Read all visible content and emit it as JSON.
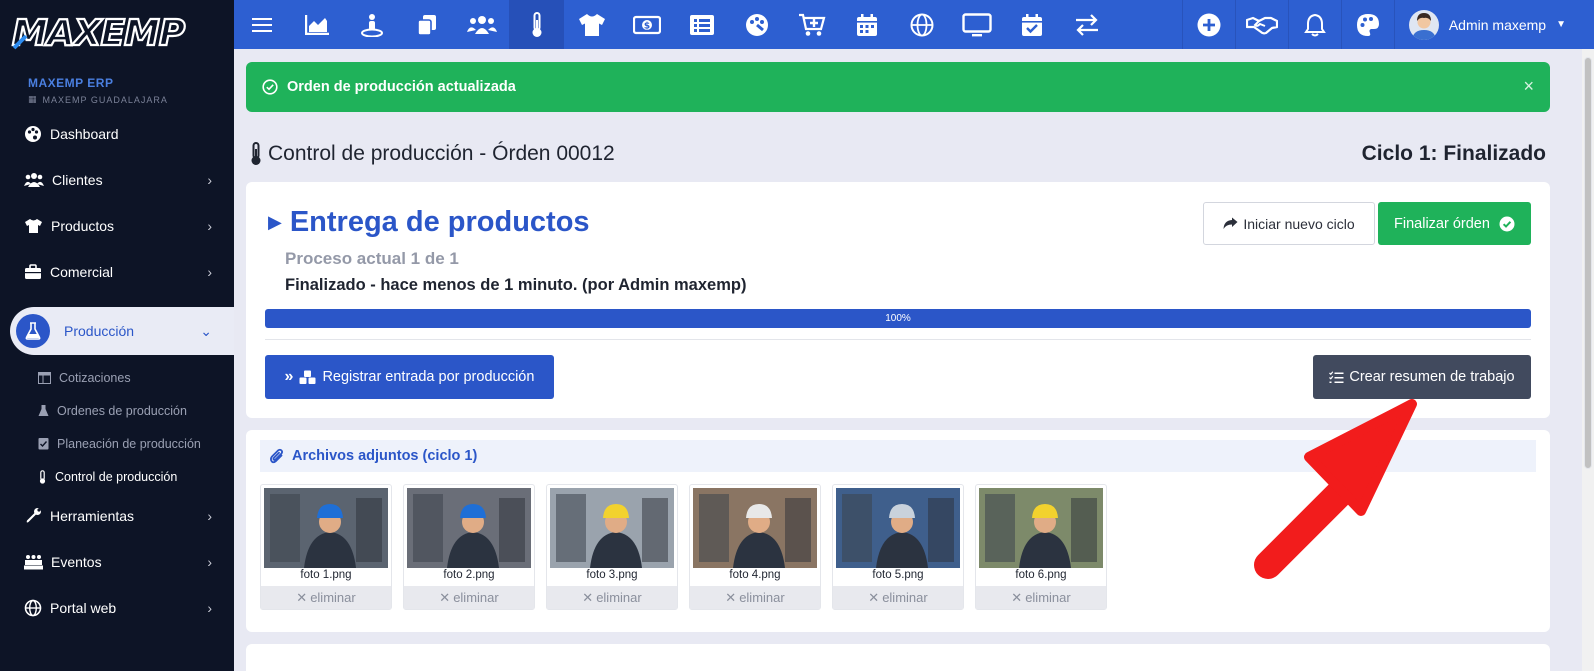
{
  "brand": {
    "logo_text": "MAXEMP",
    "org_name": "MAXEMP ERP",
    "org_sub": "MAXEMP GUADALAJARA"
  },
  "sidebar": {
    "items": [
      {
        "label": "Dashboard",
        "icon": "palette-icon"
      },
      {
        "label": "Clientes",
        "icon": "users-icon"
      },
      {
        "label": "Productos",
        "icon": "shirt-icon"
      },
      {
        "label": "Comercial",
        "icon": "briefcase-icon"
      },
      {
        "label": "Producción",
        "icon": "flask-icon",
        "active": true
      },
      {
        "label": "Herramientas",
        "icon": "wrench-icon"
      },
      {
        "label": "Eventos",
        "icon": "people-group-icon"
      },
      {
        "label": "Portal web",
        "icon": "globe-icon"
      }
    ],
    "sub_items": [
      {
        "label": "Cotizaciones",
        "icon": "table-icon"
      },
      {
        "label": "Ordenes de producción",
        "icon": "flask-icon"
      },
      {
        "label": "Planeación de producción",
        "icon": "checklist-icon"
      },
      {
        "label": "Control de producción",
        "icon": "thermometer-icon",
        "current": true
      }
    ]
  },
  "topbar": {
    "icons": [
      "menu-icon",
      "chart-icon",
      "person-pin-icon",
      "copy-icon",
      "users-icon",
      "thermometer-icon",
      "shirt-icon",
      "money-icon",
      "list-icon",
      "palette-icon",
      "cart-plus-icon",
      "calendar-icon",
      "globe-icon",
      "monitor-icon",
      "calendar-check-icon",
      "transfer-icon"
    ],
    "right_icons": [
      "plus-circle-icon",
      "handshake-icon",
      "bell-icon",
      "palette-icon"
    ],
    "user_name": "Admin maxemp"
  },
  "alert": {
    "message": "Orden de producción actualizada",
    "close": "×"
  },
  "page": {
    "title": "Control de producción - Órden 00012",
    "cycle": "Ciclo 1: Finalizado"
  },
  "stage": {
    "title": "Entrega de productos",
    "process": "Proceso actual 1 de 1",
    "status": "Finalizado - hace menos de 1 minuto. (por Admin maxemp)",
    "progress_percent": 100,
    "progress_label": "100%",
    "btn_new_cycle": "Iniciar nuevo ciclo",
    "btn_finish": "Finalizar órden",
    "btn_register": "Registrar entrada por producción",
    "btn_summary": "Crear resumen de trabajo"
  },
  "attachments": {
    "title": "Archivos adjuntos (ciclo 1)",
    "delete_label": "eliminar",
    "files": [
      {
        "name": "foto 1.png",
        "bg": "#5b6470",
        "helmet": "#1f6fd6"
      },
      {
        "name": "foto 2.png",
        "bg": "#6a6e78",
        "helmet": "#1f6fd6"
      },
      {
        "name": "foto 3.png",
        "bg": "#9aa3ad",
        "helmet": "#f2d22e"
      },
      {
        "name": "foto 4.png",
        "bg": "#8a7563",
        "helmet": "#e8e8e8"
      },
      {
        "name": "foto 5.png",
        "bg": "#3f5f8c",
        "helmet": "#c9d2dc"
      },
      {
        "name": "foto 6.png",
        "bg": "#7d8a6a",
        "helmet": "#f2d22e"
      }
    ]
  },
  "colors": {
    "primary": "#2b56c8",
    "topbar": "#2d5fd1",
    "success": "#1fb25a",
    "sidebar": "#0d1426",
    "dark_button": "#414a5e",
    "annotation_arrow": "#f21c1c"
  }
}
